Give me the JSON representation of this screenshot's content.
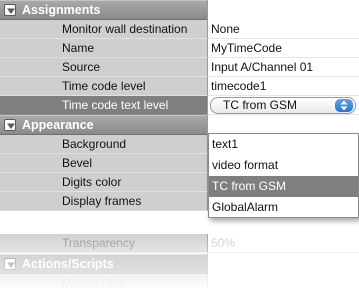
{
  "sections": [
    {
      "title": "Assignments",
      "rows": [
        {
          "label": "Monitor wall destination",
          "value": "None"
        },
        {
          "label": "Name",
          "value": "MyTimeCode"
        },
        {
          "label": "Source",
          "value": "Input A/Channel 01"
        },
        {
          "label": "Time code level",
          "value": "timecode1"
        },
        {
          "label": "Time code text level",
          "value": "TC from GSM"
        }
      ]
    },
    {
      "title": "Appearance",
      "rows": [
        {
          "label": "Background",
          "value": ""
        },
        {
          "label": "Bevel",
          "value": ""
        },
        {
          "label": "Digits color",
          "value": ""
        },
        {
          "label": "Display frames",
          "value": ""
        },
        {
          "label": "Transparency",
          "value": "50%"
        }
      ]
    },
    {
      "title": "Actions/Scripts",
      "rows": [
        {
          "label": "Mouse click",
          "value": ""
        }
      ]
    }
  ],
  "dropdown": {
    "options": [
      "text1",
      "video format",
      "TC from GSM",
      "GlobalAlarm"
    ],
    "selected": "TC from GSM"
  },
  "icons": {
    "section_toggle": "collapse-chevron-icon",
    "combo_arrows": "up-down-arrows-icon"
  },
  "colors": {
    "header_bg": "#8f8f8f",
    "label_bg": "#cfcfcf",
    "selected_bg": "#7f7f7f",
    "combo_accent": "#3b82dd"
  }
}
